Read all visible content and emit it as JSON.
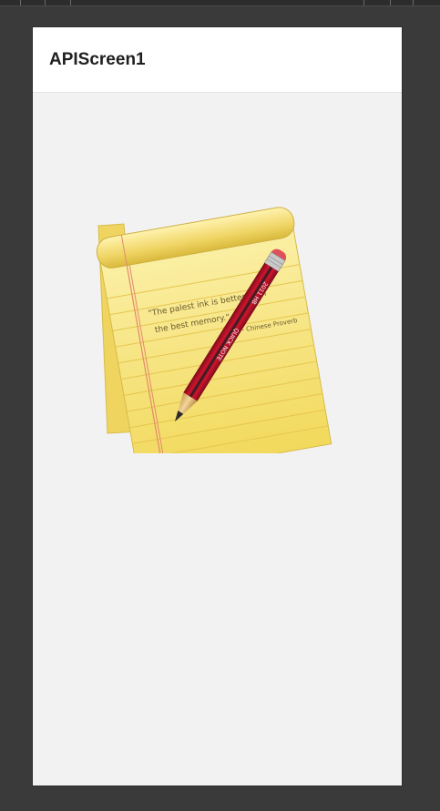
{
  "app_bar": {
    "title": "APIScreen1"
  },
  "illustration": {
    "name": "notepad-with-pencil",
    "quote_line_1": "\"The palest ink is better than",
    "quote_line_2": "the best memory.\"",
    "attribution": "- Chinese Proverb",
    "pencil_brand": "QUICK NOTE",
    "pencil_grade": "2011 HB"
  },
  "colors": {
    "page_background": "#f2f2f2",
    "app_bar": "#ffffff",
    "window_frame": "#3a3a3a",
    "notepad_yellow": "#f7e27a",
    "pencil_red": "#c8102e"
  }
}
